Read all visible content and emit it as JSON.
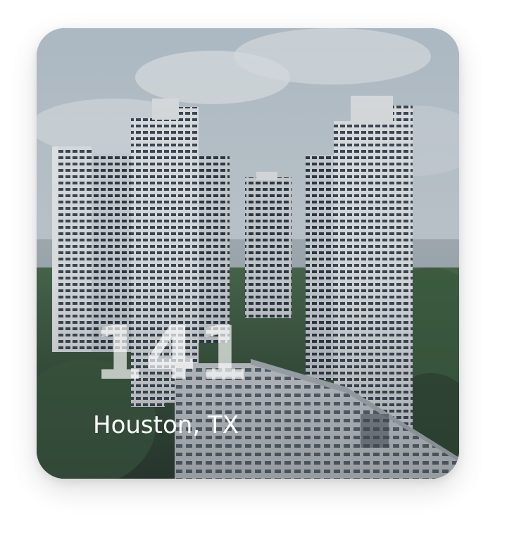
{
  "card": {
    "count": "141",
    "location": "Houston, TX",
    "image_subject": "high-rise residential towers"
  },
  "colors": {
    "overlay": "#1c232b",
    "sky": "#c8d2da",
    "text": "#ffffff"
  }
}
